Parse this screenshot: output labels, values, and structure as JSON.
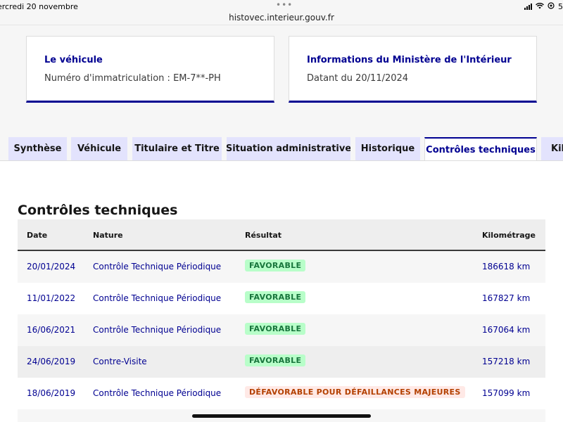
{
  "status_bar": {
    "date": "ercredi 20 novembre",
    "dots": "•••",
    "url": "histovec.interieur.gouv.fr",
    "battery": "5"
  },
  "cards": {
    "vehicle": {
      "title": "Le véhicule",
      "text": "Numéro d'immatriculation : EM-7**-PH"
    },
    "ministry": {
      "title": "Informations du Ministère de l'Intérieur",
      "text": "Datant du 20/11/2024"
    }
  },
  "tabs": [
    {
      "label": "Synthèse"
    },
    {
      "label": "Véhicule"
    },
    {
      "label": "Titulaire et Titre"
    },
    {
      "label": "Situation administrative"
    },
    {
      "label": "Historique"
    },
    {
      "label": "Contrôles techniques"
    },
    {
      "label": "Kilo"
    }
  ],
  "section": {
    "title": "Contrôles techniques"
  },
  "table": {
    "headers": {
      "date": "Date",
      "nature": "Nature",
      "result": "Résultat",
      "km": "Kilométrage"
    },
    "rows": [
      {
        "date": "20/01/2024",
        "nature": "Contrôle Technique Périodique",
        "result": "FAVORABLE",
        "km": "186618 km"
      },
      {
        "date": "11/01/2022",
        "nature": "Contrôle Technique Périodique",
        "result": "FAVORABLE",
        "km": "167827 km"
      },
      {
        "date": "16/06/2021",
        "nature": "Contrôle Technique Périodique",
        "result": "FAVORABLE",
        "km": "167064 km"
      },
      {
        "date": "24/06/2019",
        "nature": "Contre-Visite",
        "result": "FAVORABLE",
        "km": "157218 km"
      },
      {
        "date": "18/06/2019",
        "nature": "Contrôle Technique Périodique",
        "result": "DÉFAVORABLE POUR DÉFAILLANCES MAJEURES",
        "km": "157099 km"
      }
    ]
  },
  "colors": {
    "accent": "#000091",
    "tab_bg": "#e3e3fd",
    "success_bg": "#b8fec9",
    "success_text": "#18753c",
    "error_bg": "#ffe9e6",
    "error_text": "#b34000"
  }
}
